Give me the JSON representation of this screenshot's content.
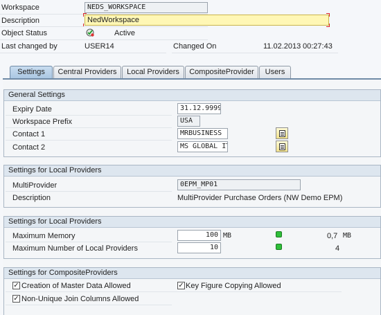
{
  "header": {
    "workspace_label": "Workspace",
    "workspace_value": "NEDS_WORKSPACE",
    "description_label": "Description",
    "description_value": "NedWorkspace",
    "status_label": "Object Status",
    "status_value": "Active",
    "changed_by_label": "Last changed by",
    "changed_by_value": "USER14",
    "changed_on_label": "Changed On",
    "changed_on_date": "11.02.2013",
    "changed_on_time": "00:27:43"
  },
  "tabs": [
    "Settings",
    "Central Providers",
    "Local Providers",
    "CompositeProvider",
    "Users"
  ],
  "general": {
    "title": "General Settings",
    "expiry_label": "Expiry Date",
    "expiry_value": "31.12.9999",
    "prefix_label": "Workspace Prefix",
    "prefix_value": "USA",
    "contact1_label": "Contact 1",
    "contact1_value": "MRBUSINESS",
    "contact2_label": "Contact 2",
    "contact2_value": "MS GLOBAL IT"
  },
  "local1": {
    "title": "Settings for Local Providers",
    "multiprovider_label": "MultiProvider",
    "multiprovider_value": "0EPM_MP01",
    "description_label": "Description",
    "description_value": "MultiProvider Purchase Orders (NW Demo EPM)"
  },
  "local2": {
    "title": "Settings for Local Providers",
    "memory_label": "Maximum Memory",
    "memory_value": "100",
    "memory_unit": "MB",
    "memory_used": "0,7",
    "memory_used_unit": "MB",
    "count_label": "Maximum Number of Local Providers",
    "count_value": "10",
    "count_used": "4"
  },
  "composite": {
    "title": "Settings for CompositeProviders",
    "master_data_label": "Creation of Master Data Allowed",
    "keyfig_label": "Key Figure Copying Allowed",
    "nonunique_label": "Non-Unique Join Columns Allowed"
  },
  "colors": {
    "status_green": "#2fbf3a",
    "required_marker": "#dd2222",
    "description_bg": "#fff7b5"
  }
}
